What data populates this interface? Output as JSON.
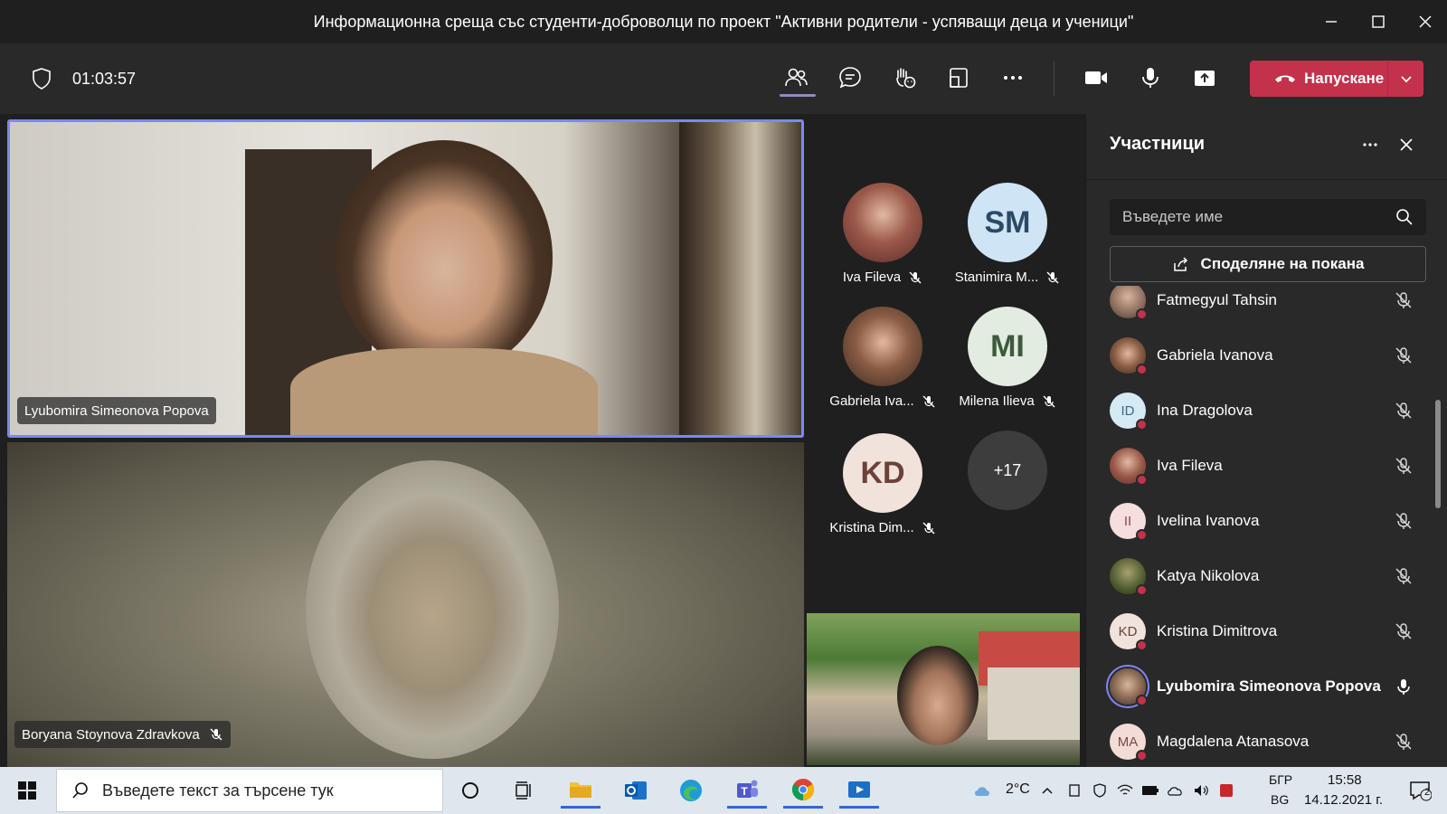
{
  "window": {
    "title": "Информационна среща със студенти-доброволци по проект \"Активни родители - успяващи деца и ученици\"",
    "minimize_icon": "minimize-icon",
    "maximize_icon": "maximize-icon",
    "close_icon": "close-icon"
  },
  "toolbar": {
    "timer": "01:03:57",
    "leave_label": "Напускане",
    "buttons": [
      "people-icon",
      "chat-icon",
      "react-icon",
      "rooms-icon",
      "more-icon",
      "camera-icon",
      "mic-icon",
      "share-icon"
    ]
  },
  "stage": {
    "main_speaker": "Lyubomira Simeonova Popova",
    "second_speaker": "Boryana Stoynova Zdravkova",
    "tiles": [
      {
        "name": "Iva Fileva",
        "initials": "",
        "avatar_color": "#7a3b3b"
      },
      {
        "name": "Stanimira M...",
        "initials": "SM",
        "avatar_color": "#cfe4f5"
      },
      {
        "name": "Gabriela Iva...",
        "initials": "",
        "avatar_color": "#5b4a3a"
      },
      {
        "name": "Milena Ilieva",
        "initials": "MI",
        "avatar_color": "#e3ece0"
      },
      {
        "name": "Kristina Dim...",
        "initials": "KD",
        "avatar_color": "#f1e2dc"
      }
    ],
    "more_count": "+17"
  },
  "panel": {
    "title": "Участници",
    "search_placeholder": "Въведете име",
    "invite_label": "Споделяне на покана",
    "participants": [
      {
        "name": "Fatmegyul Tahsin",
        "initials": "",
        "avatar_color": "#8a6a5a",
        "bold": false
      },
      {
        "name": "Gabriela Ivanova",
        "initials": "",
        "avatar_color": "#6b4e3e",
        "bold": false
      },
      {
        "name": "Ina Dragolova",
        "initials": "ID",
        "avatar_color": "#d6eaf6",
        "bold": false
      },
      {
        "name": "Iva Fileva",
        "initials": "",
        "avatar_color": "#7a3b3b",
        "bold": false
      },
      {
        "name": "Ivelina Ivanova",
        "initials": "II",
        "avatar_color": "#f6dede",
        "bold": false
      },
      {
        "name": "Katya Nikolova",
        "initials": "",
        "avatar_color": "#4d5a2e",
        "bold": false
      },
      {
        "name": "Kristina Dimitrova",
        "initials": "KD",
        "avatar_color": "#f1e2dc",
        "bold": false
      },
      {
        "name": "Lyubomira Simeonova Popova",
        "initials": "",
        "avatar_color": "#8b6a55",
        "bold": true
      },
      {
        "name": "Magdalena Atanasova",
        "initials": "MA",
        "avatar_color": "#f3dcd6",
        "bold": false
      }
    ]
  },
  "taskbar": {
    "search_text": "Въведете текст за търсене тук",
    "temperature": "2°C",
    "lang_top": "БГР",
    "lang_bottom": "BG",
    "time": "15:58",
    "date": "14.12.2021 г.",
    "notifications": "2"
  },
  "colors": {
    "accent": "#7f85f5",
    "leave": "#c4314b",
    "background": "#1f1f1f"
  }
}
